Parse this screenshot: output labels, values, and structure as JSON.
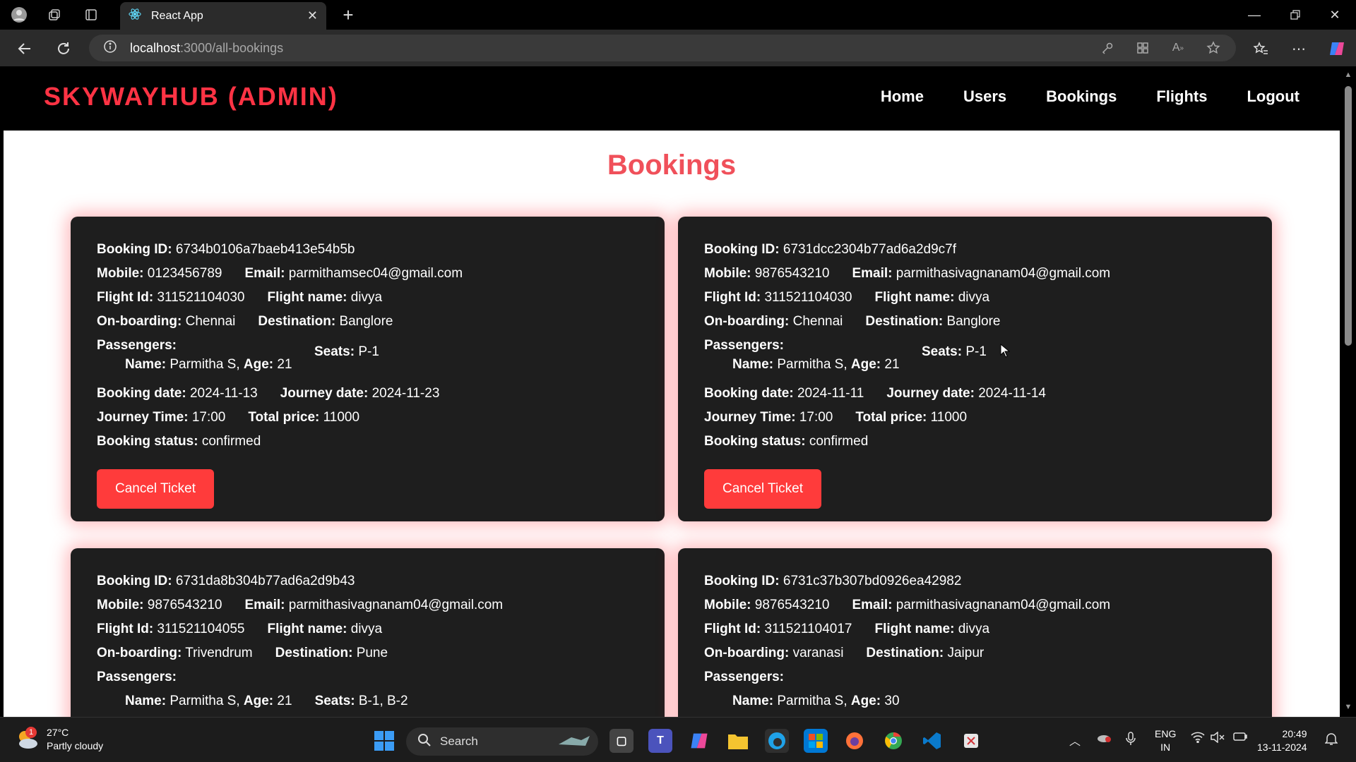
{
  "browser": {
    "tab_title": "React App",
    "url_host": "localhost",
    "url_path": ":3000/all-bookings"
  },
  "app": {
    "brand": "SKYWAYHUB (ADMIN)",
    "nav": [
      "Home",
      "Users",
      "Bookings",
      "Flights",
      "Logout"
    ],
    "page_title": "Bookings"
  },
  "labels": {
    "booking_id": "Booking ID:",
    "mobile": "Mobile:",
    "email": "Email:",
    "flight_id": "Flight Id:",
    "flight_name": "Flight name:",
    "onboarding": "On-boarding:",
    "destination": "Destination:",
    "passengers": "Passengers:",
    "name": "Name:",
    "age": "Age:",
    "seats": "Seats:",
    "booking_date": "Booking date:",
    "journey_date": "Journey date:",
    "journey_time": "Journey Time:",
    "total_price": "Total price:",
    "booking_status": "Booking status:",
    "cancel_button": "Cancel Ticket"
  },
  "bookings": [
    {
      "booking_id": "6734b0106a7baeb413e54b5b",
      "mobile": "0123456789",
      "email": "parmithamsec04@gmail.com",
      "flight_id": "311521104030",
      "flight_name": "divya",
      "onboarding": "Chennai",
      "destination": "Banglore",
      "passenger_name": "Parmitha S,",
      "passenger_age": "21",
      "seats": "P-1",
      "booking_date": "2024-11-13",
      "journey_date": "2024-11-23",
      "journey_time": "17:00",
      "total_price": "11000",
      "booking_status": "confirmed"
    },
    {
      "booking_id": "6731dcc2304b77ad6a2d9c7f",
      "mobile": "9876543210",
      "email": "parmithasivagnanam04@gmail.com",
      "flight_id": "311521104030",
      "flight_name": "divya",
      "onboarding": "Chennai",
      "destination": "Banglore",
      "passenger_name": "Parmitha S,",
      "passenger_age": "21",
      "seats": "P-1",
      "booking_date": "2024-11-11",
      "journey_date": "2024-11-14",
      "journey_time": "17:00",
      "total_price": "11000",
      "booking_status": "confirmed"
    },
    {
      "booking_id": "6731da8b304b77ad6a2d9b43",
      "mobile": "9876543210",
      "email": "parmithasivagnanam04@gmail.com",
      "flight_id": "311521104055",
      "flight_name": "divya",
      "onboarding": "Trivendrum",
      "destination": "Pune",
      "passenger_name": "Parmitha S,",
      "passenger_age": "21",
      "seats": "B-1, B-2"
    },
    {
      "booking_id": "6731c37b307bd0926ea42982",
      "mobile": "9876543210",
      "email": "parmithasivagnanam04@gmail.com",
      "flight_id": "311521104017",
      "flight_name": "divya",
      "onboarding": "varanasi",
      "destination": "Jaipur",
      "passenger_name": "Parmitha S,",
      "passenger_age": "30"
    }
  ],
  "taskbar": {
    "weather_temp": "27°C",
    "weather_desc": "Partly cloudy",
    "weather_badge": "1",
    "search_label": "Search",
    "lang_top": "ENG",
    "lang_bottom": "IN",
    "time": "20:49",
    "date": "13-11-2024"
  },
  "colors": {
    "brand": "#ff3344",
    "title": "#f0505a",
    "card_bg": "#1e1e1e",
    "button": "#ff3b3b"
  }
}
